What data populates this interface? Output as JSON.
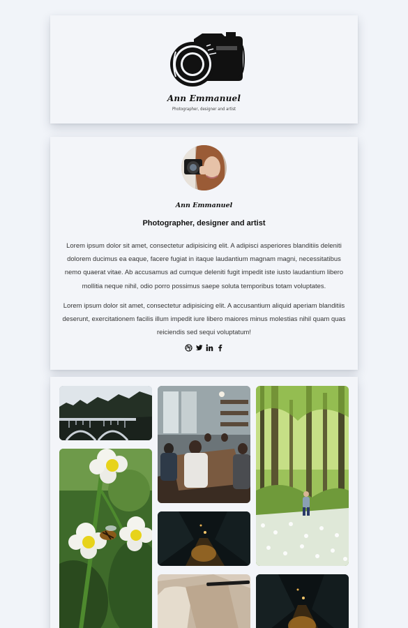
{
  "header": {
    "logo_icon": "camera-icon",
    "name": "Ann Emmanuel",
    "tagline": "Photographer, designer and artist"
  },
  "profile": {
    "avatar": "woman-with-camera-photo",
    "name": "Ann Emmanuel",
    "role": "Photographer, designer and artist",
    "bio": [
      "Lorem ipsum dolor sit amet, consectetur adipisicing elit. A adipisci asperiores blanditiis deleniti dolorem ducimus ea eaque, facere fugiat in itaque laudantium magnam magni, necessitatibus nemo quaerat vitae. Ab accusamus ad cumque deleniti fugit impedit iste iusto laudantium libero mollitia neque nihil, odio porro possimus saepe soluta temporibus totam voluptates.",
      "Lorem ipsum dolor sit amet, consectetur adipisicing elit. A accusantium aliquid aperiam blanditiis deserunt, exercitationem facilis illum impedit iure libero maiores minus molestias nihil quam quas reiciendis sed sequi voluptatum!"
    ],
    "social_icons": [
      "dribbble-icon",
      "twitter-icon",
      "linkedin-icon",
      "facebook-icon"
    ]
  },
  "gallery": {
    "photos": [
      "bridge-forest",
      "meeting-office",
      "forest-child",
      "strawberry-flowers-bee",
      "night-alley",
      "paper-pen",
      "night-alley-2"
    ]
  }
}
